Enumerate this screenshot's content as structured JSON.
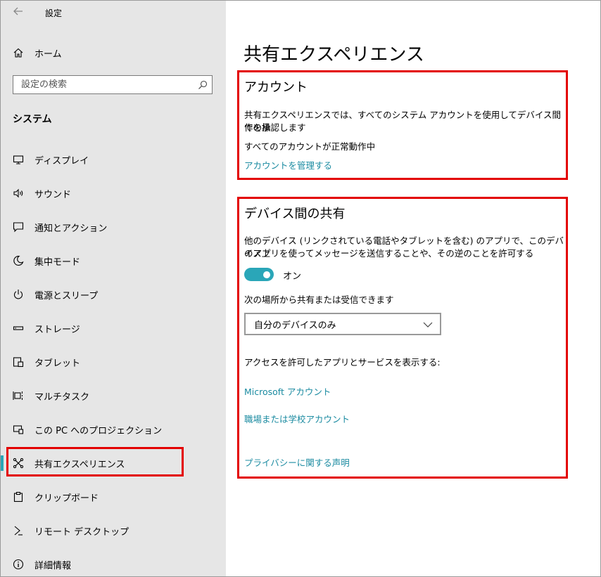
{
  "window": {
    "title": "設定"
  },
  "sidebar": {
    "home_label": "ホーム",
    "search": {
      "placeholder": "設定の検索"
    },
    "section_heading": "システム",
    "items": [
      {
        "label": "ディスプレイ",
        "icon": "display-icon"
      },
      {
        "label": "サウンド",
        "icon": "sound-icon"
      },
      {
        "label": "通知とアクション",
        "icon": "notification-icon"
      },
      {
        "label": "集中モード",
        "icon": "moon-icon"
      },
      {
        "label": "電源とスリープ",
        "icon": "power-icon"
      },
      {
        "label": "ストレージ",
        "icon": "storage-icon"
      },
      {
        "label": "タブレット",
        "icon": "tablet-icon"
      },
      {
        "label": "マルチタスク",
        "icon": "multitask-icon"
      },
      {
        "label": "この PC へのプロジェクション",
        "icon": "projection-icon"
      },
      {
        "label": "共有エクスペリエンス",
        "icon": "share-icon",
        "selected": true
      },
      {
        "label": "クリップボード",
        "icon": "clipboard-icon"
      },
      {
        "label": "リモート デスクトップ",
        "icon": "remote-desktop-icon"
      },
      {
        "label": "詳細情報",
        "icon": "info-icon"
      }
    ]
  },
  "main": {
    "title": "共有エクスペリエンス",
    "account": {
      "heading": "アカウント",
      "description_line1": "共有エクスペリエンスでは、すべてのシステム アカウントを使用してデバイス間での操",
      "description_line2": "作を承認します",
      "status": "すべてのアカウントが正常動作中",
      "manage_link": "アカウントを管理する"
    },
    "sharing": {
      "heading": "デバイス間の共有",
      "description_line1": "他のデバイス (リンクされている電話やタブレットを含む) のアプリで、このデバイス上",
      "description_line2": "のアプリを使ってメッセージを送信することや、その逆のことを許可する",
      "toggle_label": "オン",
      "toggle_on": true,
      "location_label": "次の場所から共有または受信できます",
      "location_value": "自分のデバイスのみ",
      "apps_label": "アクセスを許可したアプリとサービスを表示する:",
      "ms_account_link": "Microsoft アカウント",
      "work_account_link": "職場または学校アカウント",
      "privacy_link": "プライバシーに関する声明"
    }
  },
  "colors": {
    "accent": "#2aa6b8",
    "link": "#1b8ba1",
    "highlight": "#e30000",
    "sidebar_bg": "#e6e6e6"
  }
}
